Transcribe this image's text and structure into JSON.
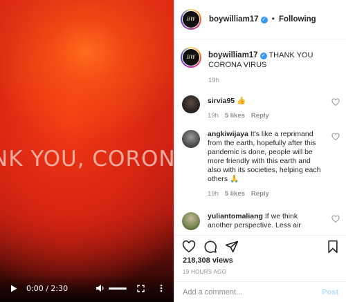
{
  "video": {
    "overlay_text": "NK YOU, CORON",
    "time": "0:00 / 2:30"
  },
  "header": {
    "username": "boywilliam17",
    "separator": "•",
    "follow_status": "Following"
  },
  "caption": {
    "username": "boywilliam17",
    "text": "THANK YOU CORONA VIRUS",
    "age": "19h"
  },
  "comments": [
    {
      "username": "sirvia95",
      "text": "👍",
      "age": "19h",
      "likes": "5 likes",
      "reply_label": "Reply",
      "avatar_color": "#2a2420"
    },
    {
      "username": "angkiwijaya",
      "text": "It's like a reprimand from the earth, hopefully after this pandemic is done, people will be more friendly with this earth and also with its societies, helping each others 🙏",
      "age": "19h",
      "likes": "5 likes",
      "reply_label": "Reply",
      "avatar_color": "#4a4a4a"
    },
    {
      "username": "yuliantomaliang",
      "text": "If we think another perspective. Less air",
      "age": "",
      "likes": "",
      "reply_label": "",
      "avatar_color": "#7a8a55"
    }
  ],
  "actions": {
    "views": "218,308 views",
    "posted": "19 HOURS AGO"
  },
  "add_comment": {
    "placeholder": "Add a comment...",
    "post_label": "Post"
  },
  "colors": {
    "verified": "#3897f0",
    "post_button": "#b2dffc"
  },
  "icons": [
    "play-icon",
    "volume-icon",
    "fullscreen-icon",
    "more-vertical-icon",
    "verified-badge-icon",
    "heart-icon",
    "comment-icon",
    "share-icon",
    "bookmark-icon"
  ]
}
